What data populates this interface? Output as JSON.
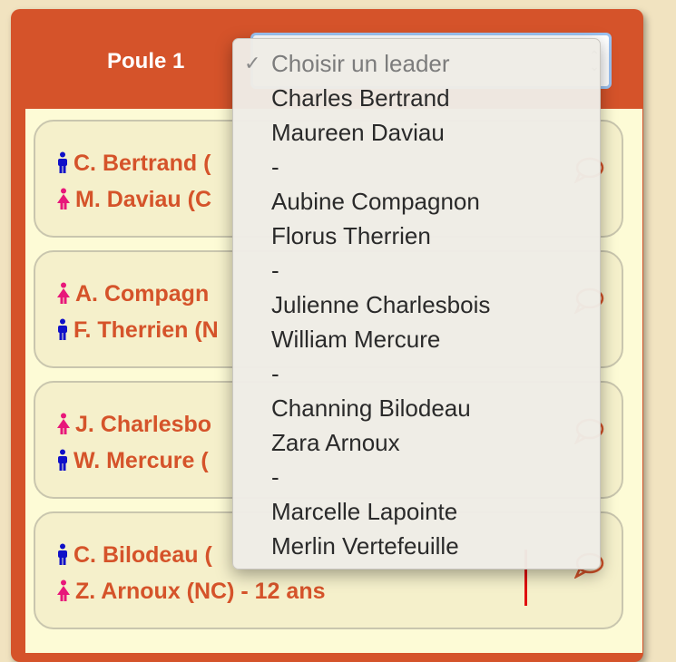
{
  "group": {
    "title": "Poule 1"
  },
  "colors": {
    "accent": "#d5532a",
    "male": "#1010c8",
    "female": "#e8177a",
    "flag": "#e01010"
  },
  "cards": [
    {
      "players": [
        {
          "gender": "male",
          "name": "C. Bertrand ("
        },
        {
          "gender": "female",
          "name": "M. Daviau (C"
        }
      ]
    },
    {
      "players": [
        {
          "gender": "female",
          "name": "A. Compagn"
        },
        {
          "gender": "male",
          "name": "F. Therrien (N"
        }
      ]
    },
    {
      "players": [
        {
          "gender": "female",
          "name": "J. Charlesbo"
        },
        {
          "gender": "male",
          "name": "W. Mercure ("
        }
      ]
    },
    {
      "players": [
        {
          "gender": "male",
          "name": "C. Bilodeau ("
        },
        {
          "gender": "female",
          "name": "Z. Arnoux (NC) - 12 ans"
        }
      ]
    }
  ],
  "leader_select": {
    "check": "✓",
    "options": [
      "Choisir un leader",
      "Charles Bertrand",
      "Maureen Daviau",
      "-",
      "Aubine Compagnon",
      "Florus Therrien",
      "-",
      "Julienne Charlesbois",
      "William Mercure",
      "-",
      "Channing Bilodeau",
      "Zara Arnoux",
      "-",
      "Marcelle Lapointe",
      "Merlin Vertefeuille"
    ]
  }
}
